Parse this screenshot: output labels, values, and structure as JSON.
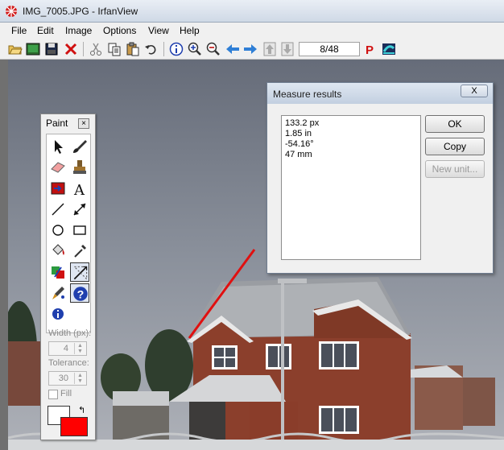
{
  "window": {
    "title": "IMG_7005.JPG - IrfanView"
  },
  "menu": [
    "File",
    "Edit",
    "Image",
    "Options",
    "View",
    "Help"
  ],
  "toolbar": {
    "page_counter": "8/48",
    "icons": [
      "open-folder-icon",
      "thumbnails-icon",
      "save-icon",
      "delete-icon",
      "cut-icon",
      "copy-icon",
      "paste-icon",
      "undo-icon",
      "info-icon",
      "zoom-in-icon",
      "zoom-out-icon",
      "previous-icon",
      "next-icon",
      "first-icon",
      "last-icon",
      "print-icon",
      "about-icon"
    ]
  },
  "paint": {
    "title": "Paint",
    "close": "×",
    "width_label": "Width (px):",
    "width_value": "4",
    "tolerance_label": "Tolerance:",
    "tolerance_value": "30",
    "fill_label": "Fill",
    "swap": "↰",
    "foreground_color": "#ff0000",
    "background_color": "#ffffff"
  },
  "measure": {
    "title": "Measure results",
    "close": "X",
    "results": [
      "133.2 px",
      "1.85 in",
      "-54.16°",
      "47 mm"
    ],
    "ok": "OK",
    "copy": "Copy",
    "new_unit": "New unit..."
  },
  "colors": {
    "measure_line": "#e01010",
    "accent": "#2b5fb3"
  }
}
